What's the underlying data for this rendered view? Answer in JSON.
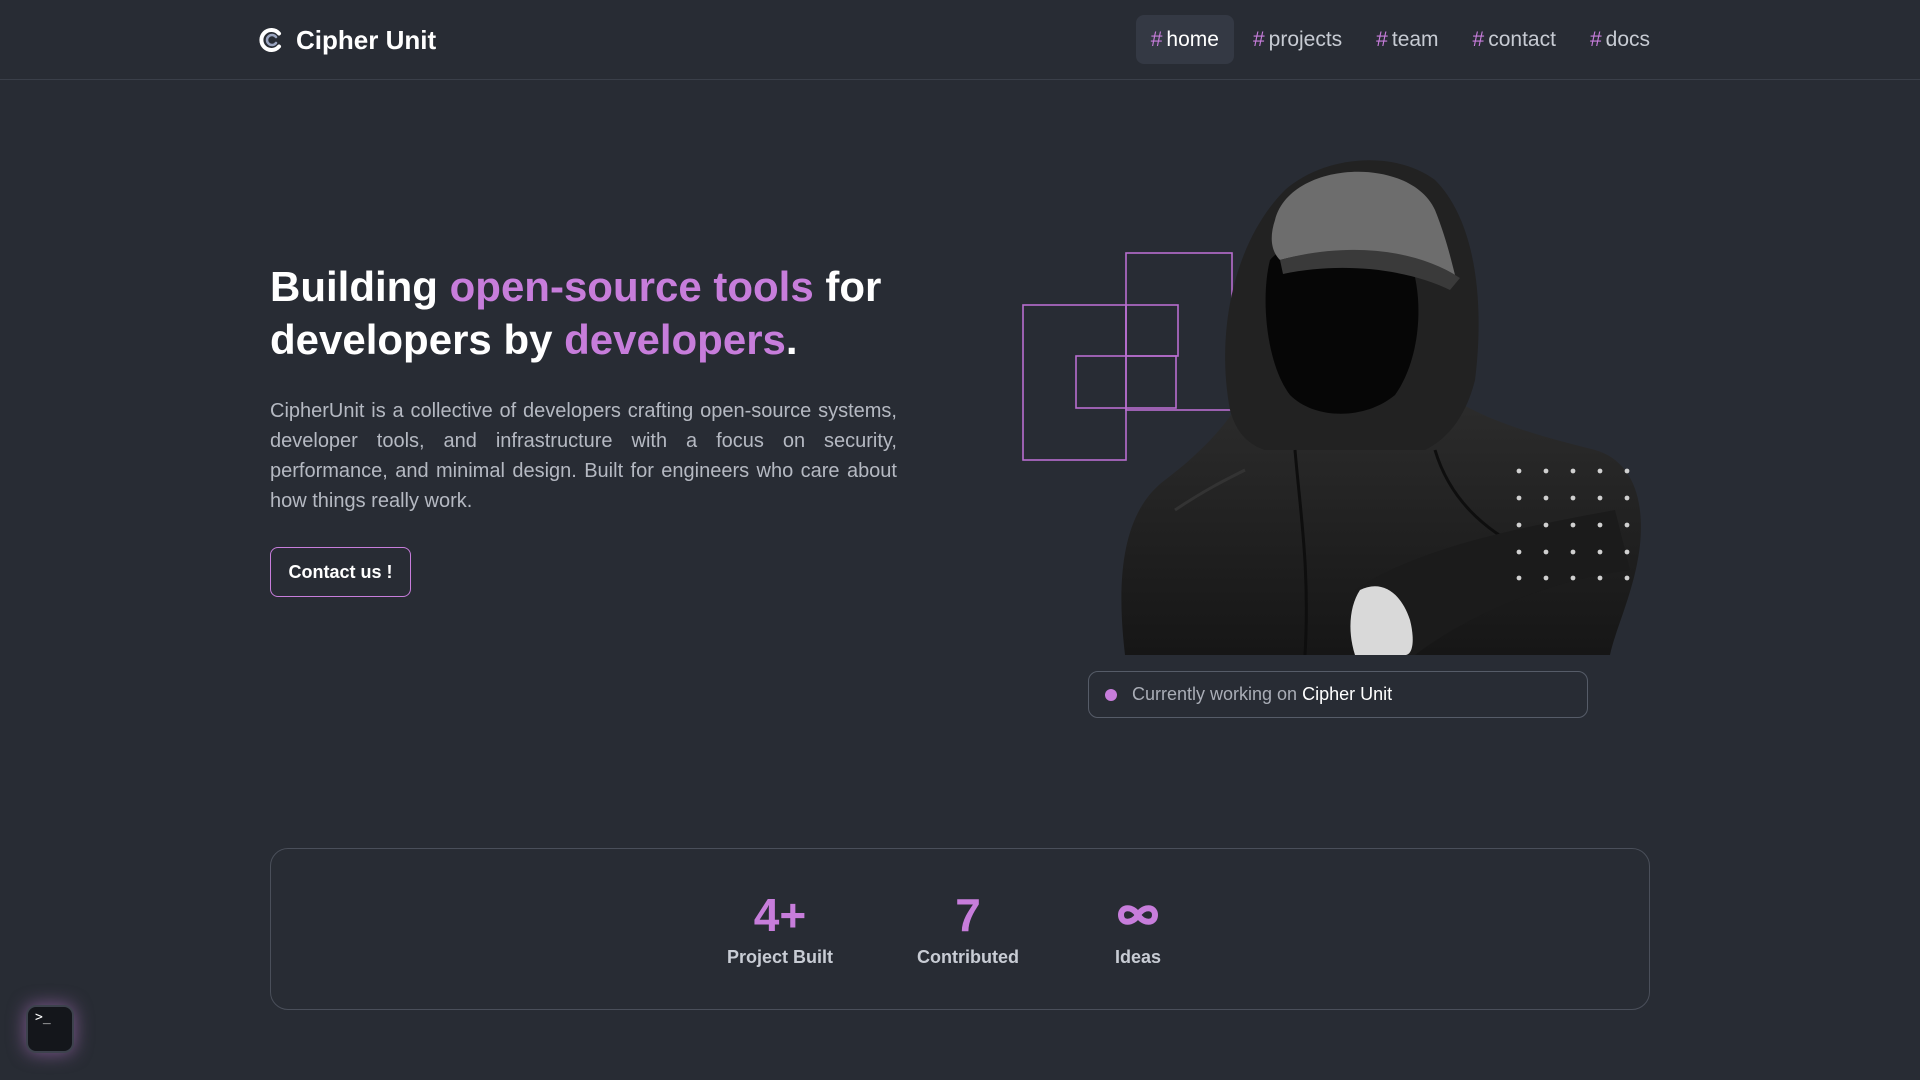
{
  "brand": {
    "name": "Cipher Unit",
    "logo_icon": "cipher-c-logo-icon"
  },
  "nav": {
    "hash": "#",
    "items": [
      {
        "label": "home",
        "active": true
      },
      {
        "label": "projects",
        "active": false
      },
      {
        "label": "team",
        "active": false
      },
      {
        "label": "contact",
        "active": false
      },
      {
        "label": "docs",
        "active": false
      }
    ]
  },
  "hero": {
    "title_part1": "Building ",
    "title_accent1": "open-source tools",
    "title_part2": " for developers by ",
    "title_accent2": "developers",
    "title_part3": ".",
    "description": "CipherUnit is a collective of developers crafting open-source systems, developer tools, and infrastructure with a focus on security, performance, and minimal design. Built for engineers who care about how things really work.",
    "cta_label": "Contact us !"
  },
  "status": {
    "prefix": "Currently working on",
    "project": "Cipher Unit"
  },
  "stats": [
    {
      "value": "4+",
      "label": "Project Built"
    },
    {
      "value": "7",
      "label": "Contributed"
    },
    {
      "value": "∞",
      "label": "Ideas",
      "icon": "infinity-icon"
    }
  ],
  "terminal": {
    "glyph": ">_",
    "icon": "terminal-icon"
  },
  "colors": {
    "background": "#282c34",
    "accent": "#c77ddb",
    "text": "#ffffff",
    "muted": "#b5b9c2"
  }
}
